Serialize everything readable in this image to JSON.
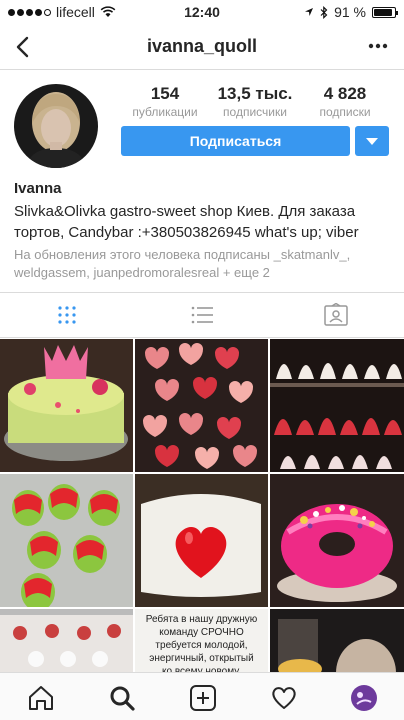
{
  "status_bar": {
    "carrier": "lifecell",
    "time": "12:40",
    "battery": "91 %",
    "battery_level": 0.91
  },
  "header": {
    "username": "ivanna_quoll"
  },
  "profile": {
    "stats": [
      {
        "value": "154",
        "label": "публикации"
      },
      {
        "value": "13,5 тыс.",
        "label": "подписчики"
      },
      {
        "value": "4 828",
        "label": "подписки"
      }
    ],
    "follow_label": "Подписаться",
    "name": "Ivanna",
    "bio_line1": "Slivka&Olivka gastro-sweet shop Киев. Для заказа",
    "bio_line2": "тортов, Candybar :+380503826945 what's up; viber",
    "followed_by_line1": "На обновления этого человека подписаны _skatmanlv_,",
    "followed_by_line2": "weldgassem, juanpedromoralesreal + еще 2"
  },
  "grid": {
    "caption_text": "Ребята в нашу дружную команду СРОЧНО требуется молодой, энергичный, открытый ко всему новому, желающий"
  },
  "colors": {
    "accent": "#3897f0",
    "text": "#262626",
    "muted": "#999999",
    "divider": "#dbdbdb"
  },
  "icons": [
    "back-arrow-icon",
    "more-dots-icon",
    "grid-view-icon",
    "list-view-icon",
    "tagged-icon",
    "home-icon",
    "search-icon",
    "add-post-icon",
    "heart-icon",
    "profile-avatar-icon",
    "wifi-icon",
    "location-arrow-icon",
    "bluetooth-icon",
    "battery-icon"
  ]
}
